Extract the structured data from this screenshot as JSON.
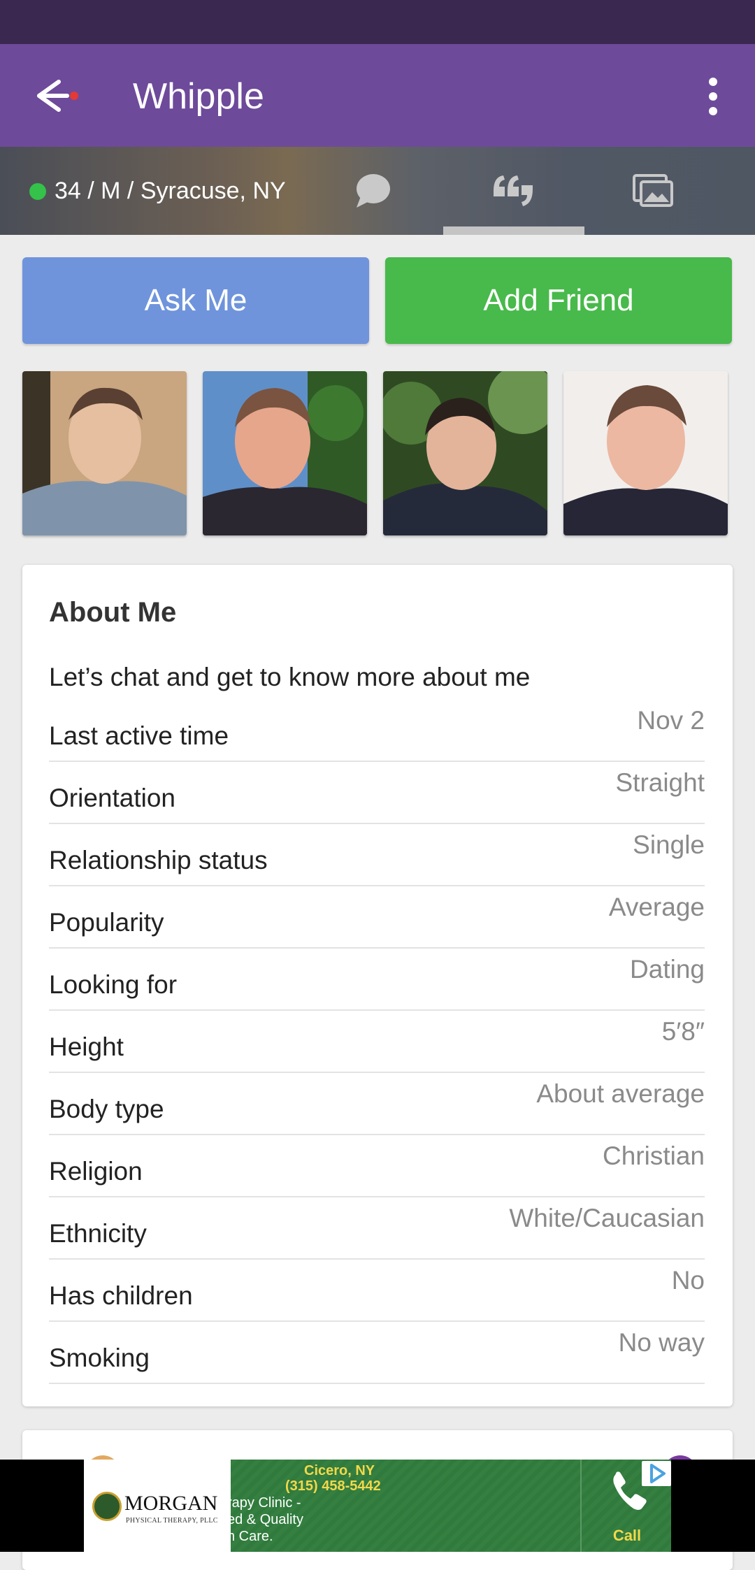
{
  "app_bar": {
    "title": "Whipple"
  },
  "profile_info": {
    "summary": "34 / M / Syracuse, NY",
    "online": true,
    "tabs": [
      {
        "icon": "chat-bubble-icon",
        "active": false
      },
      {
        "icon": "quote-icon",
        "active": true
      },
      {
        "icon": "gallery-icon",
        "active": false
      }
    ]
  },
  "actions": {
    "ask_me": "Ask Me",
    "add_friend": "Add Friend"
  },
  "about": {
    "title": "About Me",
    "description": "Let’s chat and get to know more about me",
    "rows": [
      {
        "label": "Last active time",
        "value": "Nov 2"
      },
      {
        "label": "Orientation",
        "value": "Straight"
      },
      {
        "label": "Relationship status",
        "value": "Single"
      },
      {
        "label": "Popularity",
        "value": "Average"
      },
      {
        "label": "Looking for",
        "value": "Dating"
      },
      {
        "label": "Height",
        "value": "5′8″"
      },
      {
        "label": "Body type",
        "value": "About average"
      },
      {
        "label": "Religion",
        "value": "Christian"
      },
      {
        "label": "Ethnicity",
        "value": "White/Caucasian"
      },
      {
        "label": "Has children",
        "value": "No"
      },
      {
        "label": "Smoking",
        "value": "No way"
      }
    ]
  },
  "ad": {
    "logo_name": "MORGAN",
    "logo_sub": "PHYSICAL THERAPY, PLLC",
    "location": "Cicero, NY",
    "phone": "(315) 458-5442",
    "text_line1": "rapy Clinic -",
    "text_line2": "ed & Quality",
    "text_line3": "n Care.",
    "call_label": "Call"
  },
  "colors": {
    "app_bar": "#6e4a9a",
    "status_bar": "#3a2850",
    "ask_button": "#6f94dc",
    "add_button": "#48b94b",
    "online": "#34c24a"
  }
}
